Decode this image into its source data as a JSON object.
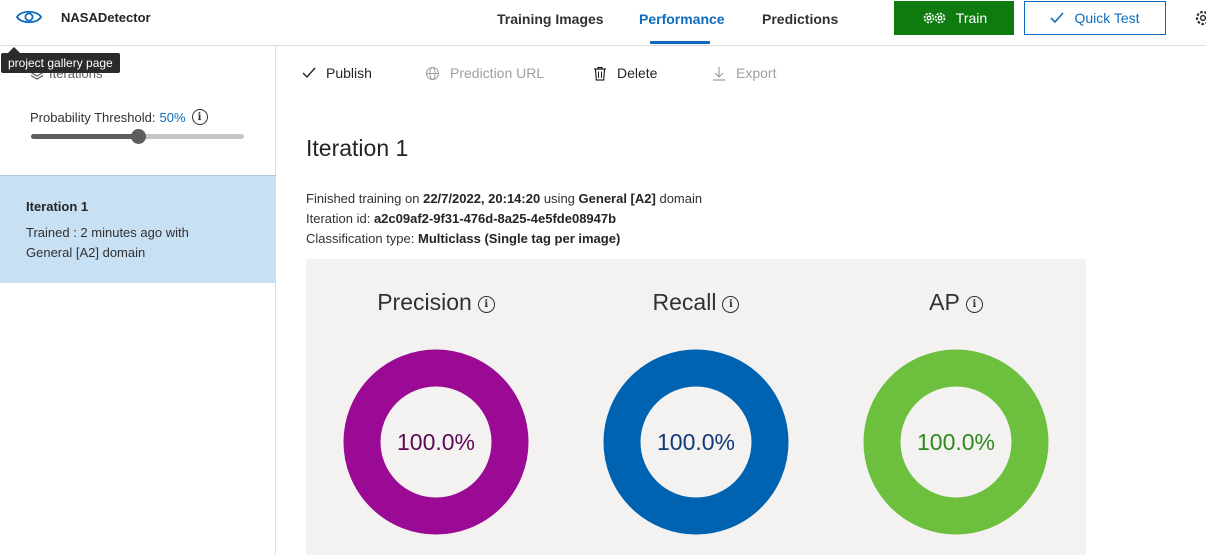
{
  "header": {
    "app_title": "NASADetector",
    "tabs": [
      {
        "label": "Training Images",
        "active": false
      },
      {
        "label": "Performance",
        "active": true
      },
      {
        "label": "Predictions",
        "active": false
      }
    ],
    "train_label": "Train",
    "quick_test_label": "Quick Test",
    "tooltip": "project gallery page"
  },
  "sidebar": {
    "iterations_label": "Iterations",
    "threshold_label": "Probability Threshold:",
    "threshold_value": "50%",
    "threshold_fraction": 0.5,
    "iteration": {
      "name": "Iteration 1",
      "description": "Trained : 2 minutes ago with General [A2] domain"
    }
  },
  "toolbar": {
    "publish": "Publish",
    "prediction_url": "Prediction URL",
    "delete": "Delete",
    "export": "Export"
  },
  "main": {
    "title": "Iteration 1",
    "training": {
      "prefix": "Finished training on",
      "date": "22/7/2022, 20:14:20",
      "middle": "using",
      "domain": "General [A2]",
      "suffix": "domain"
    },
    "iteration_id": {
      "label": "Iteration id:",
      "value": "a2c09af2-9f31-476d-8a25-4e5fde08947b"
    },
    "classification": {
      "label": "Classification type:",
      "value": "Multiclass (Single tag per image)"
    }
  },
  "metrics": [
    {
      "title": "Precision",
      "value": "100.0%",
      "fraction": 1.0,
      "color": "#9b0a94",
      "text_color": "#5c0a58"
    },
    {
      "title": "Recall",
      "value": "100.0%",
      "fraction": 1.0,
      "color": "#0063b1",
      "text_color": "#0f3a7a"
    },
    {
      "title": "AP",
      "value": "100.0%",
      "fraction": 1.0,
      "color": "#6cc03d",
      "text_color": "#2e8b1e"
    }
  ],
  "colors": {
    "accent": "#0f6cbd",
    "train_green": "#0f7b0f",
    "selection": "#c7e0f4"
  },
  "icons": {
    "app": "eye-icon",
    "train": "gears-icon",
    "quick_test": "checkmark-icon",
    "settings": "gear-icon",
    "publish": "checkmark-icon",
    "prediction_url": "globe-icon",
    "delete": "trash-icon",
    "export": "download-icon",
    "info": "info-icon"
  }
}
